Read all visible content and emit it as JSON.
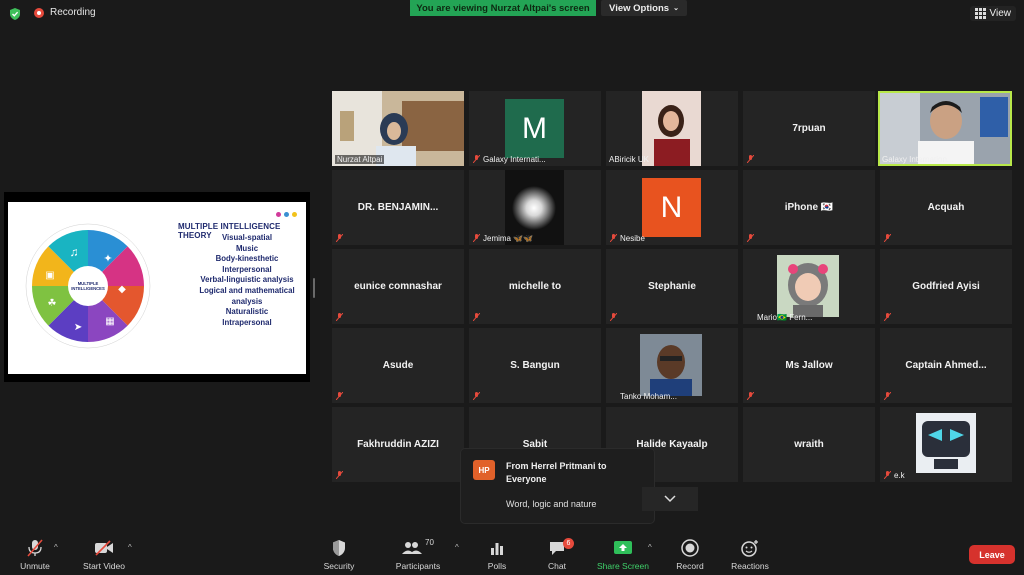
{
  "topbar": {
    "recording_label": "Recording",
    "viewing_banner": "You are viewing Nurzat Altpai's screen",
    "view_options_label": "View Options",
    "view_label": "View"
  },
  "shared_slide": {
    "title": "MULTIPLE INTELLIGENCE THEORY",
    "items": [
      "Visual-spatial",
      "Music",
      "Body-kinesthetic",
      "Interpersonal",
      "Verbal-linguistic analysis",
      "Logical and mathematical analysis",
      "Naturalistic",
      "Intrapersonal"
    ],
    "wheel_center": "MULTIPLE INTELLIGENCES",
    "colors": {
      "accent_dots": [
        "#d13a9a",
        "#3a8fd1",
        "#f2c21b"
      ]
    }
  },
  "participants": [
    {
      "name": "Nurzat Altpai",
      "display": "label"
    },
    {
      "name": "Galaxy Internati...",
      "display": "label",
      "avatar_letter": "M",
      "avatar_color": "#1f6b4d"
    },
    {
      "name": "ABiricik UK",
      "display": "label"
    },
    {
      "name": "7rpuan",
      "display": "center"
    },
    {
      "name": "Galaxy Internation...",
      "display": "label",
      "active_speaker": true
    },
    {
      "name": "DR. BENJAMIN...",
      "display": "center"
    },
    {
      "name": "Jemima 🦋🦋",
      "display": "label"
    },
    {
      "name": "Nesibe",
      "display": "label",
      "avatar_letter": "N",
      "avatar_color": "#e8531f"
    },
    {
      "name": "iPhone 🇰🇷",
      "display": "center"
    },
    {
      "name": "Acquah",
      "display": "center"
    },
    {
      "name": "eunice comnashar",
      "display": "center"
    },
    {
      "name": "michelle to",
      "display": "center"
    },
    {
      "name": "Stephanie",
      "display": "center"
    },
    {
      "name": "Mario🇧🇷 Fern...",
      "display": "label"
    },
    {
      "name": "Godfried Ayisi",
      "display": "center"
    },
    {
      "name": "Asude",
      "display": "center"
    },
    {
      "name": "S. Bangun",
      "display": "center"
    },
    {
      "name": "Tanko Moham...",
      "display": "label"
    },
    {
      "name": "Ms Jallow",
      "display": "center"
    },
    {
      "name": "Captain Ahmed...",
      "display": "center"
    },
    {
      "name": "Fakhruddin AZIZI",
      "display": "center"
    },
    {
      "name": "Sabit",
      "display": "center"
    },
    {
      "name": "Halide Kayaalp",
      "display": "center"
    },
    {
      "name": "wraith",
      "display": "center"
    },
    {
      "name": "e.k",
      "display": "label"
    }
  ],
  "chat_notification": {
    "initials": "HP",
    "from": "From Herrel Pritmani to Everyone",
    "message": "Word, logic and nature"
  },
  "toolbar": {
    "unmute": "Unmute",
    "start_video": "Start Video",
    "security": "Security",
    "participants": "Participants",
    "participants_count": "70",
    "polls": "Polls",
    "chat": "Chat",
    "chat_badge": "6",
    "share_screen": "Share Screen",
    "record": "Record",
    "reactions": "Reactions",
    "leave": "Leave"
  }
}
